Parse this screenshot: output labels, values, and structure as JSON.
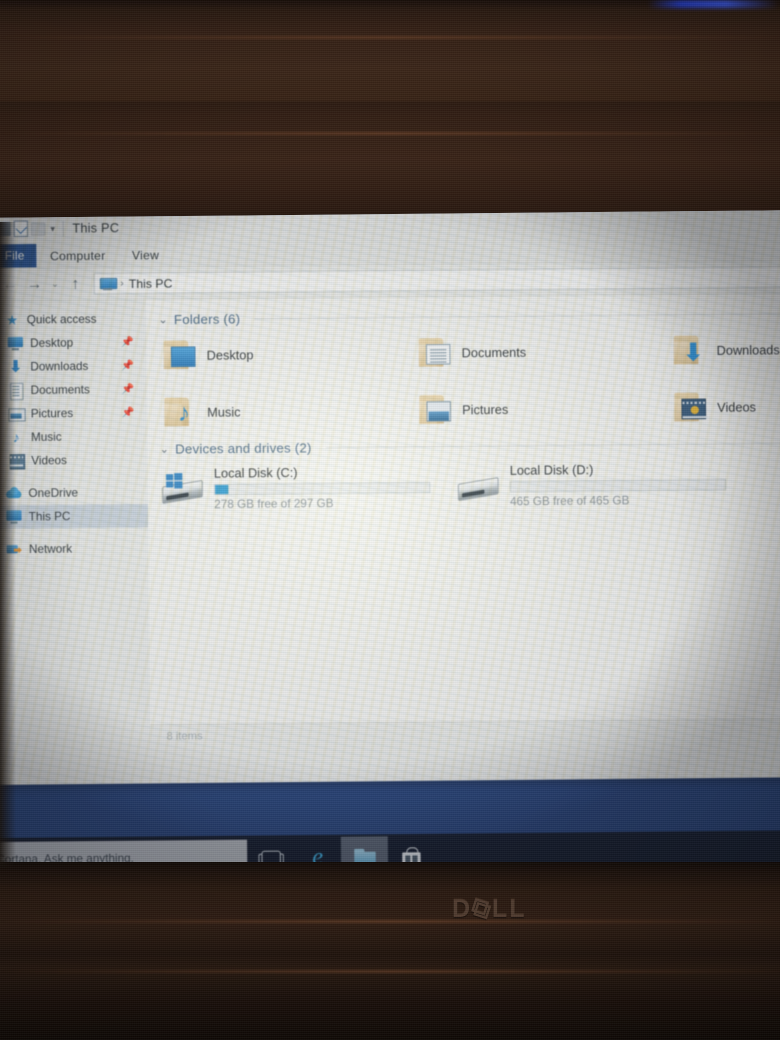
{
  "window": {
    "title": "This PC",
    "quick_access_toolbar": [
      "save-icon",
      "properties-icon",
      "new-folder-icon",
      "chevron-down-icon"
    ],
    "tabs": [
      {
        "label": "File",
        "active": true
      },
      {
        "label": "Computer",
        "active": false
      },
      {
        "label": "View",
        "active": false
      }
    ],
    "navigation": {
      "back": "←",
      "forward": "→",
      "recent": "⌄",
      "up": "↑",
      "address_icon": "this-pc-icon",
      "address_separator": "›",
      "address_text": "This PC"
    },
    "status_bar": {
      "item_count": "8 items"
    }
  },
  "sidebar": {
    "items": [
      {
        "label": "Quick access",
        "icon": "star-icon",
        "pinned": false,
        "selected": false,
        "root": true
      },
      {
        "label": "Desktop",
        "icon": "desktop-icon",
        "pinned": true,
        "selected": false,
        "root": false
      },
      {
        "label": "Downloads",
        "icon": "download-icon",
        "pinned": true,
        "selected": false,
        "root": false
      },
      {
        "label": "Documents",
        "icon": "document-icon",
        "pinned": true,
        "selected": false,
        "root": false
      },
      {
        "label": "Pictures",
        "icon": "picture-icon",
        "pinned": true,
        "selected": false,
        "root": false
      },
      {
        "label": "Music",
        "icon": "music-note-icon",
        "pinned": false,
        "selected": false,
        "root": false
      },
      {
        "label": "Videos",
        "icon": "video-icon",
        "pinned": false,
        "selected": false,
        "root": false
      },
      {
        "label": "OneDrive",
        "icon": "cloud-icon",
        "pinned": false,
        "selected": false,
        "root": true
      },
      {
        "label": "This PC",
        "icon": "this-pc-icon",
        "pinned": false,
        "selected": true,
        "root": true
      },
      {
        "label": "Network",
        "icon": "network-icon",
        "pinned": false,
        "selected": false,
        "root": true
      }
    ],
    "pin_glyph": "\u0001"
  },
  "content": {
    "folders_group": {
      "chevron": "⌄",
      "title": "Folders (6)",
      "items": [
        {
          "label": "Desktop",
          "badge": "desktop-badge"
        },
        {
          "label": "Documents",
          "badge": "document-badge"
        },
        {
          "label": "Downloads",
          "badge": "download-badge"
        },
        {
          "label": "Music",
          "badge": "music-badge"
        },
        {
          "label": "Pictures",
          "badge": "picture-badge"
        },
        {
          "label": "Videos",
          "badge": "video-badge"
        }
      ]
    },
    "drives_group": {
      "chevron": "⌄",
      "title": "Devices and drives (2)",
      "items": [
        {
          "name": "Local Disk (C:)",
          "free_text": "278 GB free of 297 GB",
          "free_gb": 278,
          "total_gb": 297,
          "used_percent": 6,
          "has_windows_logo": true
        },
        {
          "name": "Local Disk (D:)",
          "free_text": "465 GB free of 465 GB",
          "free_gb": 465,
          "total_gb": 465,
          "used_percent": 0,
          "has_windows_logo": false
        }
      ]
    }
  },
  "taskbar": {
    "cortana_placeholder": "Cortana. Ask me anything.",
    "buttons": [
      {
        "name": "task-view",
        "icon": "task-view-icon",
        "active": false
      },
      {
        "name": "edge",
        "icon": "edge-icon",
        "glyph": "e",
        "active": false
      },
      {
        "name": "file-explorer",
        "icon": "file-explorer-icon",
        "active": true
      },
      {
        "name": "microsoft-store",
        "icon": "store-icon",
        "active": false
      }
    ]
  },
  "hardware": {
    "brand": "D∧LL",
    "brand_prefix": "D",
    "brand_mid": "⧉",
    "brand_suffix": "LL"
  },
  "colors": {
    "accent": "#2b5797",
    "drive_bar": "#2f9fd9",
    "group_header": "#4a6b8a",
    "selection": "#cdd7e2"
  }
}
